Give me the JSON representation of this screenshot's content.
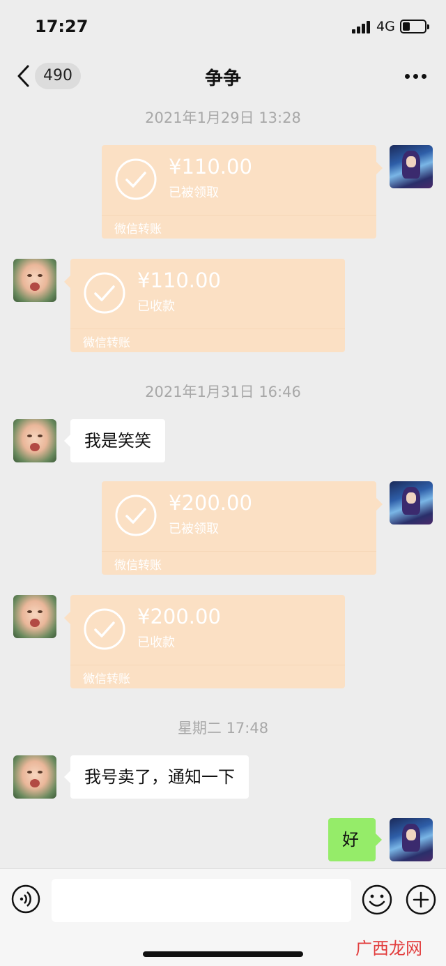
{
  "status_bar": {
    "time": "17:27",
    "network": "4G",
    "signal_icon": "signal-bars-icon",
    "battery_icon": "battery-icon"
  },
  "nav": {
    "back_icon": "chevron-left-icon",
    "unread_count": "490",
    "title": "争争",
    "more_icon": "ellipsis-icon"
  },
  "messages": {
    "ts1": "2021年1月29日 13:28",
    "t1": {
      "amount": "¥110.00",
      "status": "已被领取",
      "source": "微信转账"
    },
    "t2": {
      "amount": "¥110.00",
      "status": "已收款",
      "source": "微信转账"
    },
    "ts2": "2021年1月31日 16:46",
    "m1": "我是笑笑",
    "t3": {
      "amount": "¥200.00",
      "status": "已被领取",
      "source": "微信转账"
    },
    "t4": {
      "amount": "¥200.00",
      "status": "已收款",
      "source": "微信转账"
    },
    "ts3": "星期二 17:48",
    "m2": "我号卖了，通知一下",
    "m3": "好"
  },
  "input_bar": {
    "voice_icon": "voice-icon",
    "input_value": "",
    "emoji_icon": "emoji-icon",
    "plus_icon": "plus-icon"
  },
  "colors": {
    "background": "#ededed",
    "transfer_card": "#fbe0c4",
    "sent_bubble": "#95ec69",
    "received_bubble": "#ffffff"
  },
  "watermark": "广西龙网"
}
